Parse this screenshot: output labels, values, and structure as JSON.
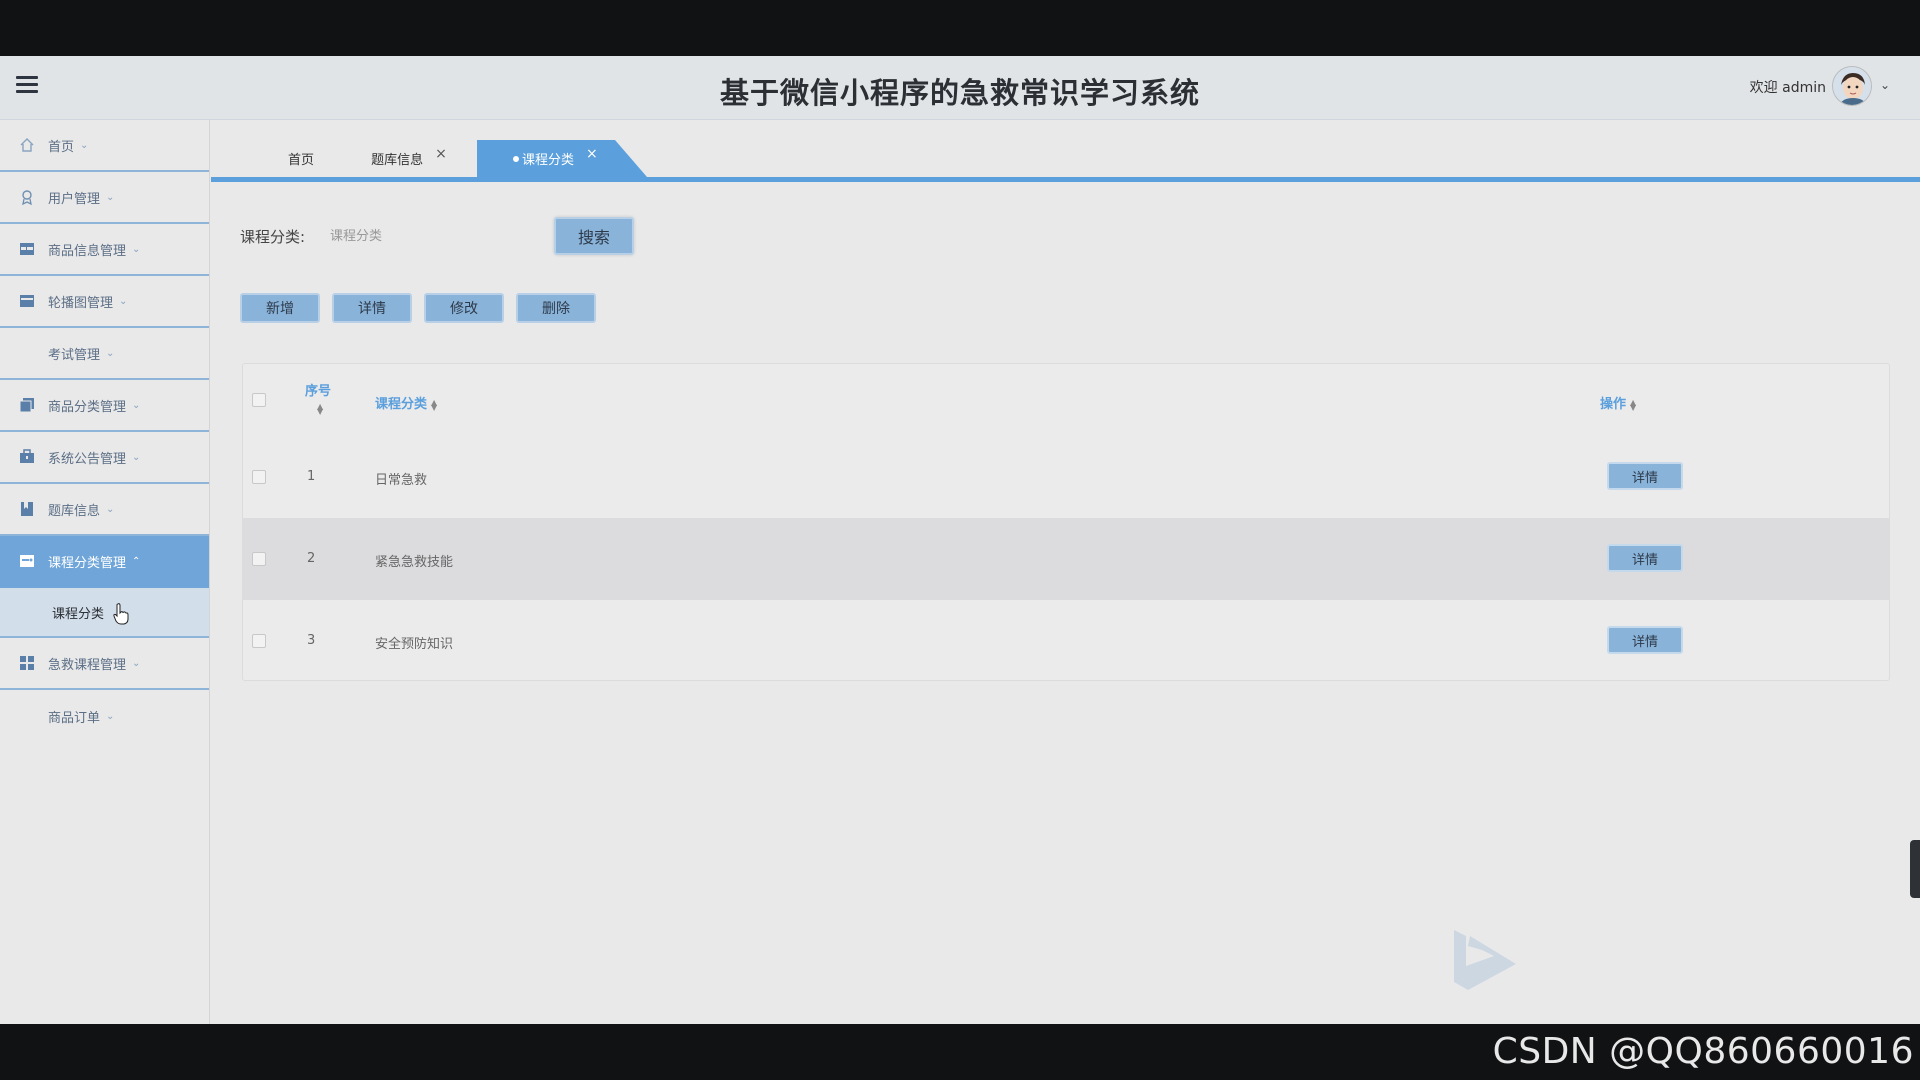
{
  "header": {
    "title": "基于微信小程序的急救常识学习系统",
    "welcome": "欢迎 admin"
  },
  "sidebar": {
    "items": [
      {
        "label": "首页",
        "icon": "home-icon"
      },
      {
        "label": "用户管理",
        "icon": "user-icon"
      },
      {
        "label": "商品信息管理",
        "icon": "table-icon"
      },
      {
        "label": "轮播图管理",
        "icon": "carousel-icon"
      },
      {
        "label": "考试管理",
        "icon": ""
      },
      {
        "label": "商品分类管理",
        "icon": "copy-icon"
      },
      {
        "label": "系统公告管理",
        "icon": "briefcase-icon"
      },
      {
        "label": "题库信息",
        "icon": "bookmark-icon"
      },
      {
        "label": "课程分类管理",
        "icon": "folder-icon"
      },
      {
        "label": "急救课程管理",
        "icon": "grid-icon"
      },
      {
        "label": "商品订单",
        "icon": ""
      }
    ],
    "sub_item": "课程分类"
  },
  "tabs": [
    {
      "label": "首页"
    },
    {
      "label": "题库信息"
    },
    {
      "label": "课程分类"
    }
  ],
  "search": {
    "label": "课程分类:",
    "placeholder": "课程分类",
    "button": "搜索"
  },
  "actions": {
    "add": "新增",
    "detail": "详情",
    "edit": "修改",
    "delete": "删除"
  },
  "table": {
    "headers": {
      "index": "序号",
      "category": "课程分类",
      "ops": "操作"
    },
    "rows": [
      {
        "index": "1",
        "category": "日常急救",
        "action": "详情"
      },
      {
        "index": "2",
        "category": "紧急急救技能",
        "action": "详情"
      },
      {
        "index": "3",
        "category": "安全预防知识",
        "action": "详情"
      }
    ]
  },
  "watermark": "CSDN @QQ860660016",
  "colors": {
    "accent": "#5b9fdc",
    "button": "#8ab3d9",
    "background": "#e9e9ea"
  }
}
